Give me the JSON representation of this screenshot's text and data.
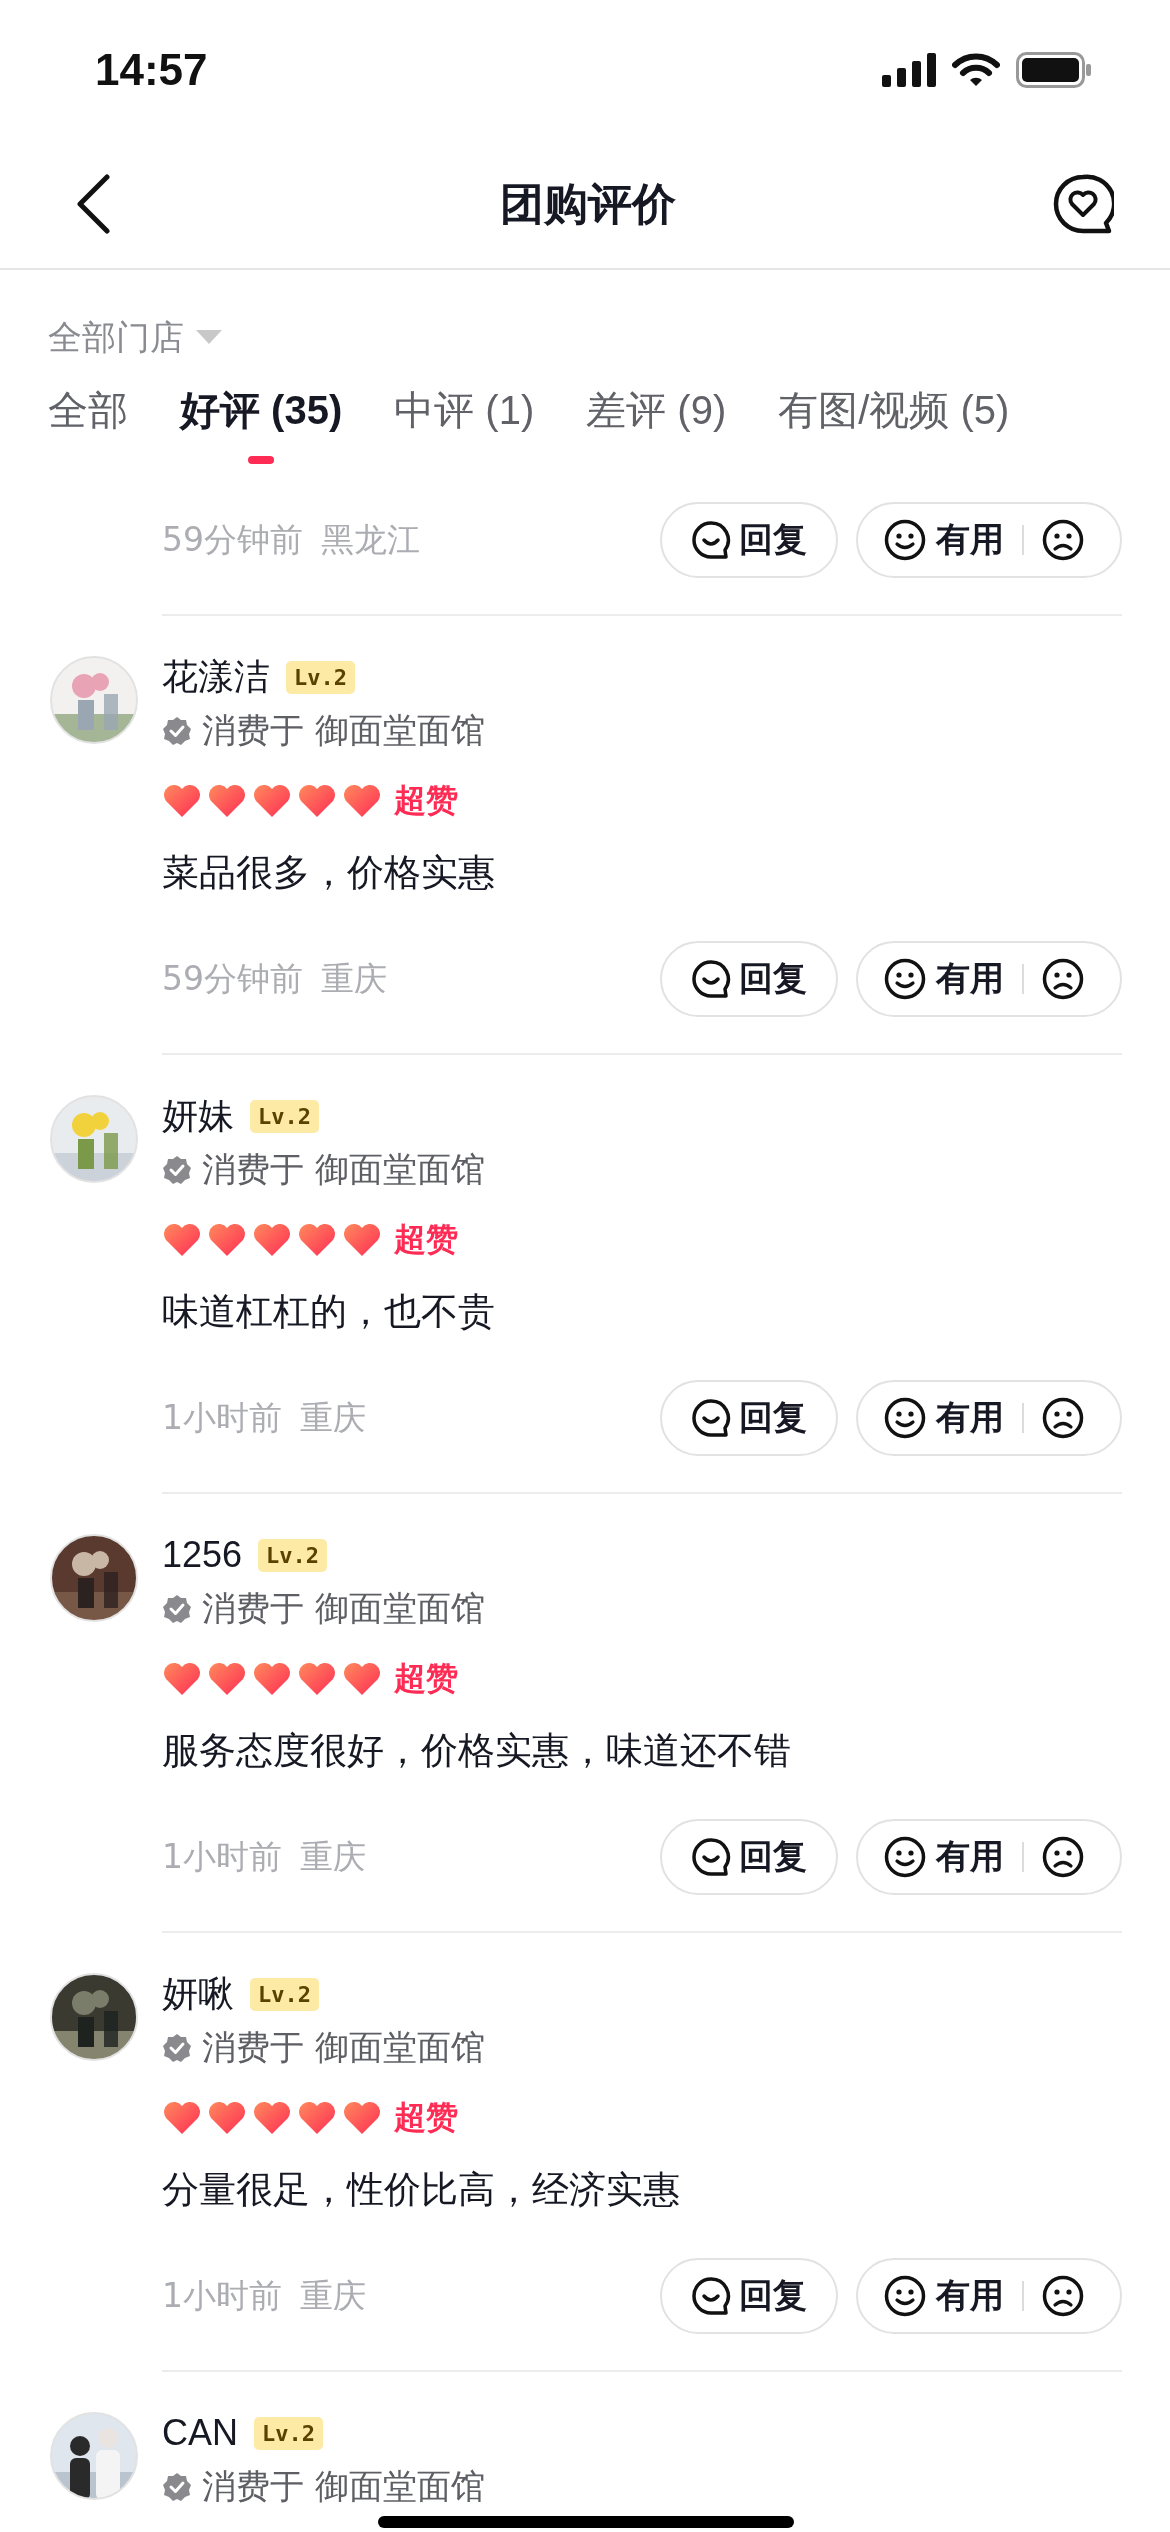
{
  "status_bar": {
    "time": "14:57"
  },
  "header": {
    "title": "团购评价"
  },
  "store_filter": {
    "label": "全部门店"
  },
  "tabs": [
    {
      "label": "全部",
      "selected": false
    },
    {
      "label": "好评 (35)",
      "selected": true
    },
    {
      "label": "中评 (1)",
      "selected": false
    },
    {
      "label": "差评 (9)",
      "selected": false
    },
    {
      "label": "有图/视频 (5)",
      "selected": false
    }
  ],
  "partial_top_review": {
    "time": "59分钟前",
    "location": "黑龙江",
    "reply": "回复",
    "useful": "有用"
  },
  "reviews": [
    {
      "name": "花漾洁",
      "level": "Lv.2",
      "shop": "消费于 御面堂面馆",
      "stars": 5,
      "rating_label": "超赞",
      "text": "菜品很多，价格实惠",
      "time": "59分钟前",
      "location": "重庆",
      "reply": "回复",
      "useful": "有用"
    },
    {
      "name": "妍妹",
      "level": "Lv.2",
      "shop": "消费于 御面堂面馆",
      "stars": 5,
      "rating_label": "超赞",
      "text": "味道杠杠的，也不贵",
      "time": "1小时前",
      "location": "重庆",
      "reply": "回复",
      "useful": "有用"
    },
    {
      "name": "1256",
      "level": "Lv.2",
      "shop": "消费于 御面堂面馆",
      "stars": 5,
      "rating_label": "超赞",
      "text": "服务态度很好，价格实惠，味道还不错",
      "time": "1小时前",
      "location": "重庆",
      "reply": "回复",
      "useful": "有用"
    },
    {
      "name": "妍啾",
      "level": "Lv.2",
      "shop": "消费于 御面堂面馆",
      "stars": 5,
      "rating_label": "超赞",
      "text": "分量很足，性价比高，经济实惠",
      "time": "1小时前",
      "location": "重庆",
      "reply": "回复",
      "useful": "有用"
    }
  ],
  "partial_bottom_review": {
    "name": "CAN",
    "level": "Lv.2",
    "shop": "消费于 御面堂面馆"
  }
}
